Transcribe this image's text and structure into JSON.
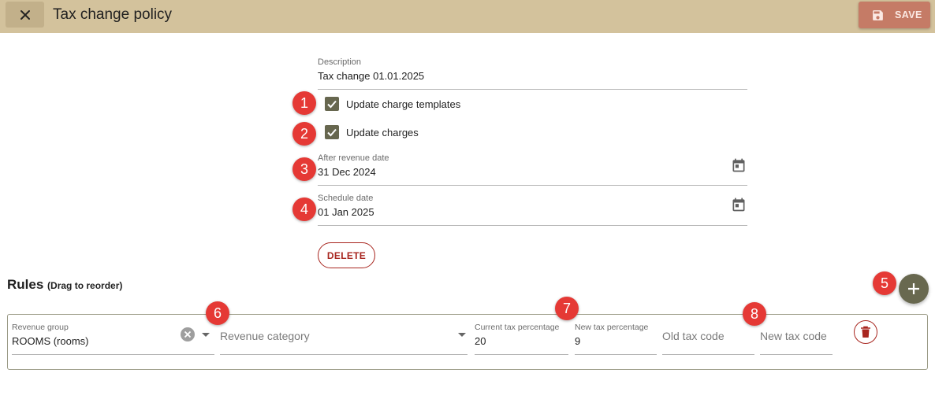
{
  "header": {
    "title": "Tax change policy",
    "save_label": "SAVE",
    "colors": {
      "bar": "#d3c29c",
      "save": "#c57b66"
    }
  },
  "form": {
    "description": {
      "label": "Description",
      "value": "Tax change 01.01.2025"
    },
    "update_charge_templates": {
      "label": "Update charge templates",
      "checked": true
    },
    "update_charges": {
      "label": "Update charges",
      "checked": true
    },
    "after_revenue_date": {
      "label": "After revenue date",
      "value": "31 Dec 2024"
    },
    "schedule_date": {
      "label": "Schedule date",
      "value": "01 Jan 2025"
    },
    "delete_label": "DELETE"
  },
  "rules": {
    "title": "Rules",
    "hint": "(Drag to reorder)",
    "items": [
      {
        "revenue_group_label": "Revenue group",
        "revenue_group_value": "ROOMS (rooms)",
        "revenue_category_placeholder": "Revenue category",
        "current_tax_label": "Current tax percentage",
        "current_tax_value": "20",
        "new_tax_label": "New tax percentage",
        "new_tax_value": "9",
        "old_tax_code_placeholder": "Old tax code",
        "new_tax_code_placeholder": "New tax code"
      }
    ]
  },
  "annotations": [
    "1",
    "2",
    "3",
    "4",
    "5",
    "6",
    "7",
    "8"
  ],
  "icons": [
    "close-icon",
    "save-icon",
    "calendar-icon",
    "check-icon",
    "plus-icon",
    "clear-icon",
    "dropdown-icon",
    "trash-icon"
  ]
}
